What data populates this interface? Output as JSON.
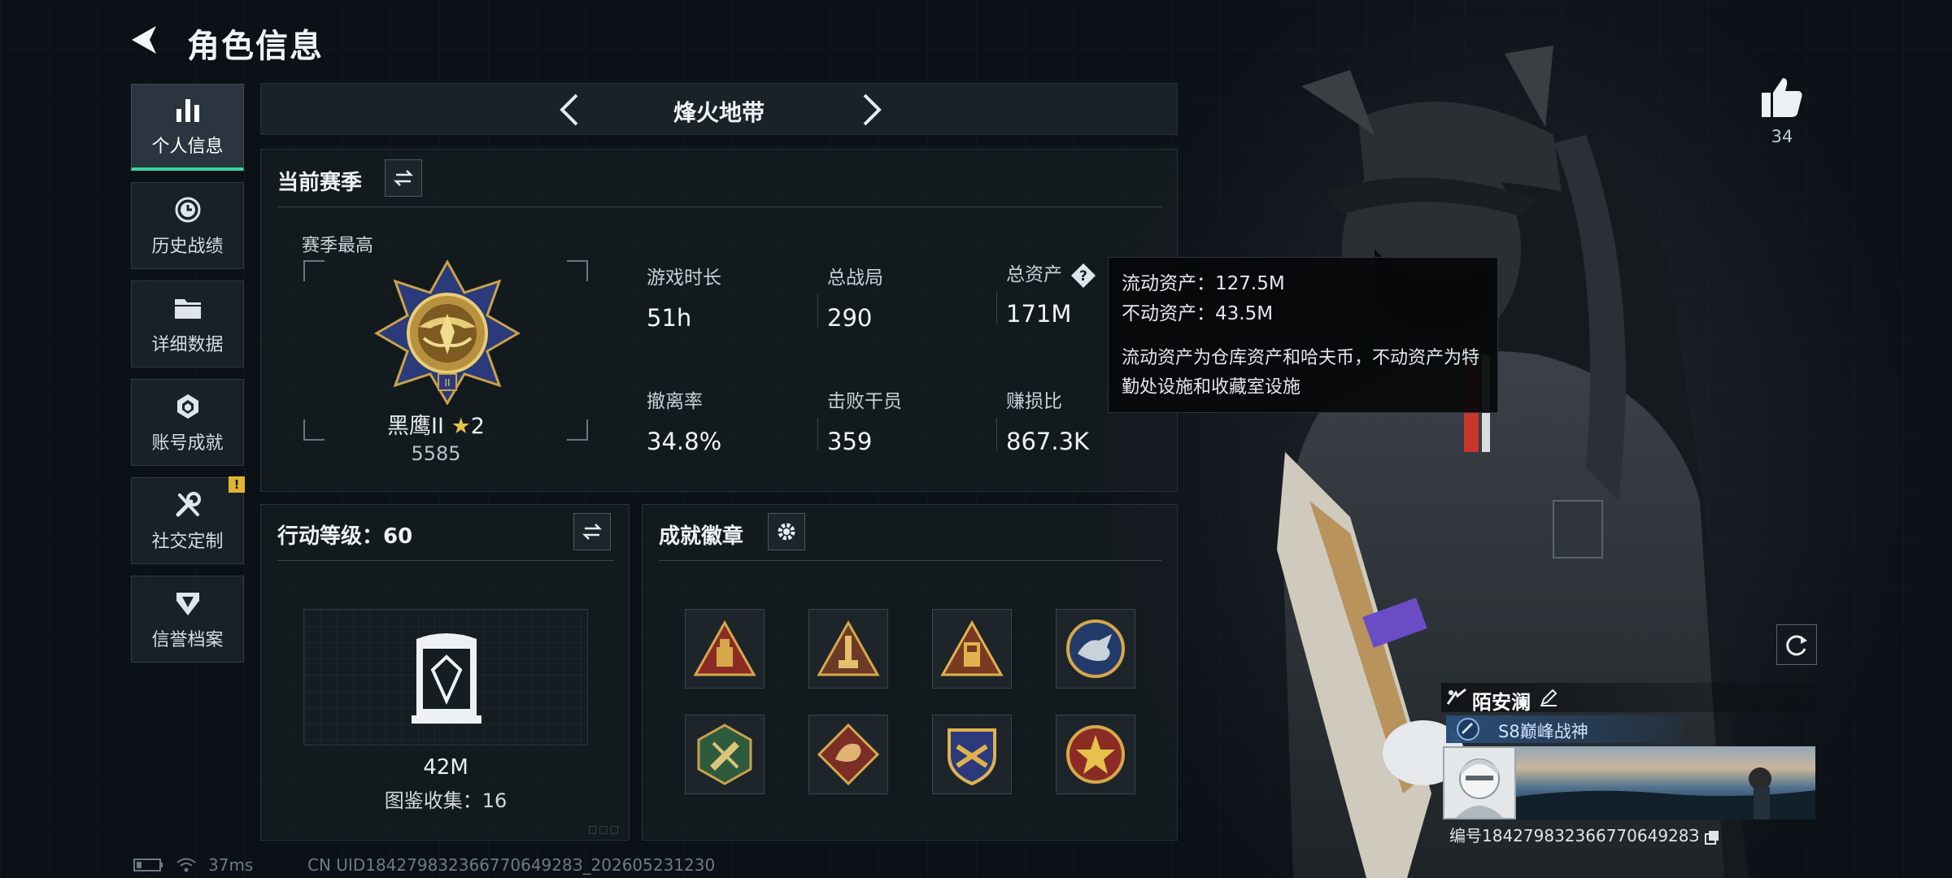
{
  "header": {
    "title": "角色信息"
  },
  "nav": {
    "items": [
      {
        "label": "个人信息",
        "icon": "bar-chart-icon",
        "active": true
      },
      {
        "label": "历史战绩",
        "icon": "clock-icon"
      },
      {
        "label": "详细数据",
        "icon": "folder-icon"
      },
      {
        "label": "账号成就",
        "icon": "achievement-icon"
      },
      {
        "label": "社交定制",
        "icon": "tools-icon",
        "badge": "!"
      },
      {
        "label": "信誉档案",
        "icon": "shield-icon"
      }
    ]
  },
  "mode": {
    "title": "烽火地带"
  },
  "season": {
    "title": "当前赛季",
    "best_label": "赛季最高",
    "rank_name": "黑鹰II",
    "rank_stars": "2",
    "rank_score": "5585",
    "stats": [
      {
        "label": "游戏时长",
        "value": "51h"
      },
      {
        "label": "总战局",
        "value": "290"
      },
      {
        "label": "总资产",
        "value": "171M"
      },
      {
        "label": "撤离率",
        "value": "34.8%"
      },
      {
        "label": "击败干员",
        "value": "359"
      },
      {
        "label": "赚损比",
        "value": "867.3K"
      }
    ]
  },
  "tooltip": {
    "liquid": "流动资产：127.5M",
    "fixed": "不动资产：43.5M",
    "desc": "流动资产为仓库资产和哈夫币，不动资产为特勤处设施和收藏室设施"
  },
  "action": {
    "title": "行动等级：60",
    "value": "42M",
    "collection": "图鉴收集：16"
  },
  "achievements": {
    "title": "成就徽章",
    "badges": [
      "triangle-badge-red",
      "triangle-badge-tower",
      "triangle-badge-gold",
      "round-badge-wolf",
      "hex-badge-green",
      "diamond-badge-dragon",
      "shield-badge-gold",
      "round-badge-star"
    ]
  },
  "right": {
    "like_count": "34",
    "player_name": "陌安澜",
    "player_title": "S8巅峰战神",
    "uid": "编号18427983236677064928З"
  },
  "footer": {
    "latency": "37ms",
    "uid_line": "CN UID18427983236677064928З_202605231230"
  },
  "colors": {
    "accent": "#38d39f",
    "gold": "#e6c24a",
    "panel": "#151b20"
  }
}
